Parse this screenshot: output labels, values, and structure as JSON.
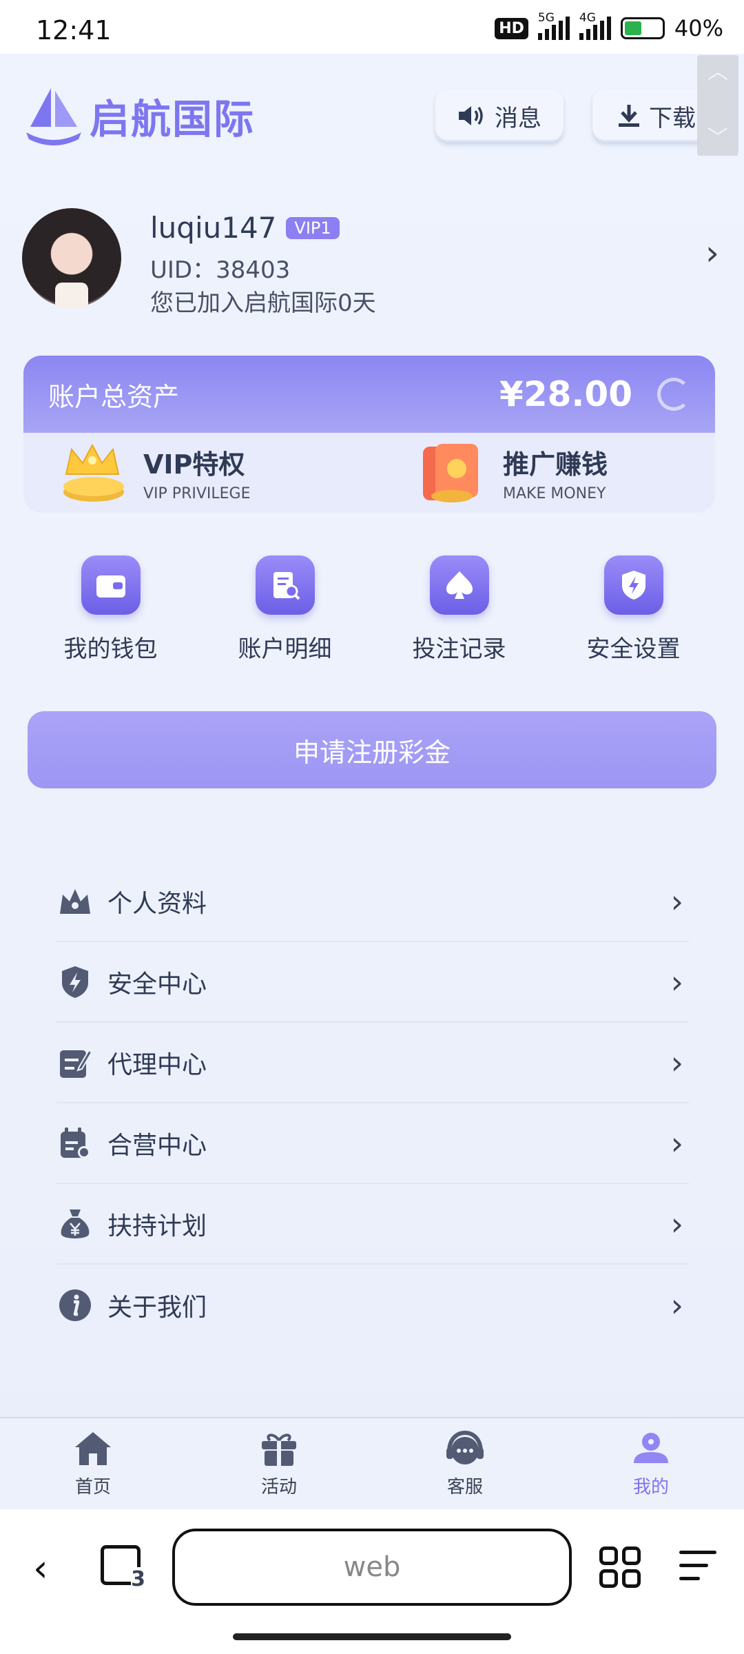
{
  "status_bar": {
    "time": "12:41",
    "hd": "HD",
    "net1": "5G",
    "net2": "4G",
    "battery": "40%"
  },
  "header": {
    "logo_text": "启航国际",
    "message_label": "消息",
    "download_label": "下载"
  },
  "profile": {
    "username": "luqiu147",
    "vip_badge": "VIP1",
    "uid": "UID：38403",
    "joined": "您已加入启航国际0天"
  },
  "assets": {
    "label": "账户总资产",
    "value": "¥28.00",
    "vip": {
      "title": "VIP特权",
      "subtitle": "VIP PRIVILEGE"
    },
    "promo": {
      "title": "推广赚钱",
      "subtitle": "MAKE MONEY"
    }
  },
  "quick_actions": [
    {
      "label": "我的钱包",
      "icon": "wallet-icon"
    },
    {
      "label": "账户明细",
      "icon": "account-detail-icon"
    },
    {
      "label": "投注记录",
      "icon": "spade-icon"
    },
    {
      "label": "安全设置",
      "icon": "shield-icon"
    }
  ],
  "apply_button": "申请注册彩金",
  "menu": [
    {
      "label": "个人资料",
      "icon": "crown-icon"
    },
    {
      "label": "安全中心",
      "icon": "shield-bolt-icon"
    },
    {
      "label": "代理中心",
      "icon": "edit-icon"
    },
    {
      "label": "合营中心",
      "icon": "calendar-icon"
    },
    {
      "label": "扶持计划",
      "icon": "money-bag-icon"
    },
    {
      "label": "关于我们",
      "icon": "info-icon"
    }
  ],
  "tabbar": [
    {
      "label": "首页",
      "icon": "home-icon"
    },
    {
      "label": "活动",
      "icon": "gift-icon"
    },
    {
      "label": "客服",
      "icon": "headset-icon"
    },
    {
      "label": "我的",
      "icon": "user-icon",
      "active": true
    }
  ],
  "browser": {
    "url_text": "web",
    "tab_count": "3"
  },
  "colors": {
    "accent": "#7d76f0",
    "tab_active": "#7f74ee",
    "text": "#2f3a55"
  }
}
